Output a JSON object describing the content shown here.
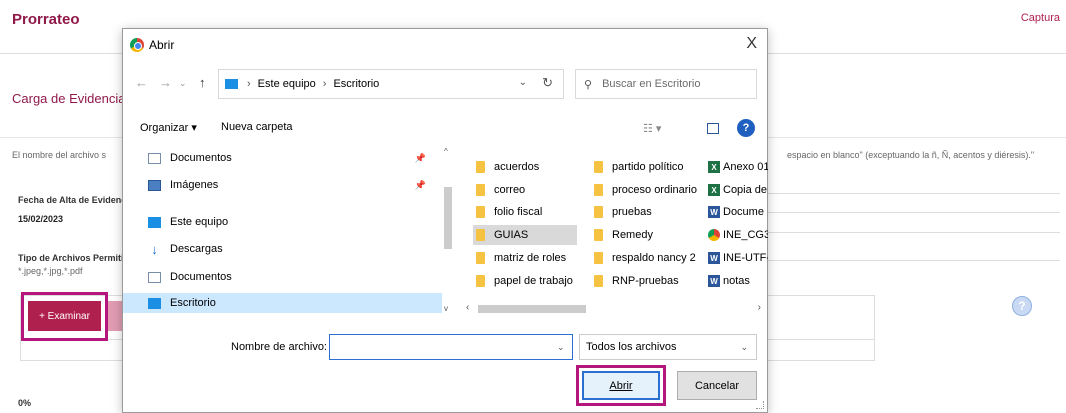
{
  "background": {
    "title": "Prorrateo",
    "top_right_link": "Captura",
    "section_title": "Carga de Evidencias",
    "note_left": "El nombre del archivo s",
    "note_right": "espacio en blanco\" (exceptuando la ñ, Ñ, acentos y diéresis).\"",
    "fecha_label": "Fecha de Alta de Evidenc",
    "fecha_value": "15/02/2023",
    "tipo_label": "Tipo de Archivos Permiti",
    "tipo_value": "*.jpeg,*.jpg,*.pdf",
    "examinar_label": "+ Examinar",
    "percent": "0%"
  },
  "dialog": {
    "title": "Abrir",
    "close_glyph": "X",
    "address": {
      "crumbs": [
        "Este equipo",
        "Escritorio"
      ]
    },
    "search_placeholder": "Buscar en Escritorio",
    "toolbar": {
      "organize": "Organizar ▾",
      "new_folder": "Nueva carpeta"
    },
    "nav_items": [
      {
        "label": "Documentos",
        "icon": "document-icon",
        "pinned": true
      },
      {
        "label": "Imágenes",
        "icon": "pictures-icon",
        "pinned": true
      },
      {
        "label": "Este equipo",
        "icon": "pc-icon",
        "pinned": false
      },
      {
        "label": "Descargas",
        "icon": "download-icon",
        "pinned": false
      },
      {
        "label": "Documentos",
        "icon": "document-icon",
        "pinned": false
      },
      {
        "label": "Escritorio",
        "icon": "desktop-icon",
        "pinned": false,
        "selected": true
      }
    ],
    "files": {
      "col1": [
        "acuerdos",
        "correo",
        "folio fiscal",
        "GUIAS",
        "matriz de roles",
        "papel de trabajo"
      ],
      "col2": [
        "partido político",
        "proceso ordinario",
        "pruebas",
        "Remedy",
        "respaldo nancy 2",
        "RNP-pruebas"
      ],
      "col3": [
        {
          "name": "Anexo 01",
          "type": "excel-icon"
        },
        {
          "name": "Copia de",
          "type": "excel-icon"
        },
        {
          "name": "Docume",
          "type": "word-icon"
        },
        {
          "name": "INE_CG3",
          "type": "chrome-icon"
        },
        {
          "name": "INE-UTF-",
          "type": "word-icon"
        },
        {
          "name": "notas",
          "type": "word-icon"
        }
      ]
    },
    "filename_label": "Nombre de archivo:",
    "filename_value": "",
    "filter_value": "Todos los archivos",
    "open_button": "Abrir",
    "cancel_button": "Cancelar"
  }
}
